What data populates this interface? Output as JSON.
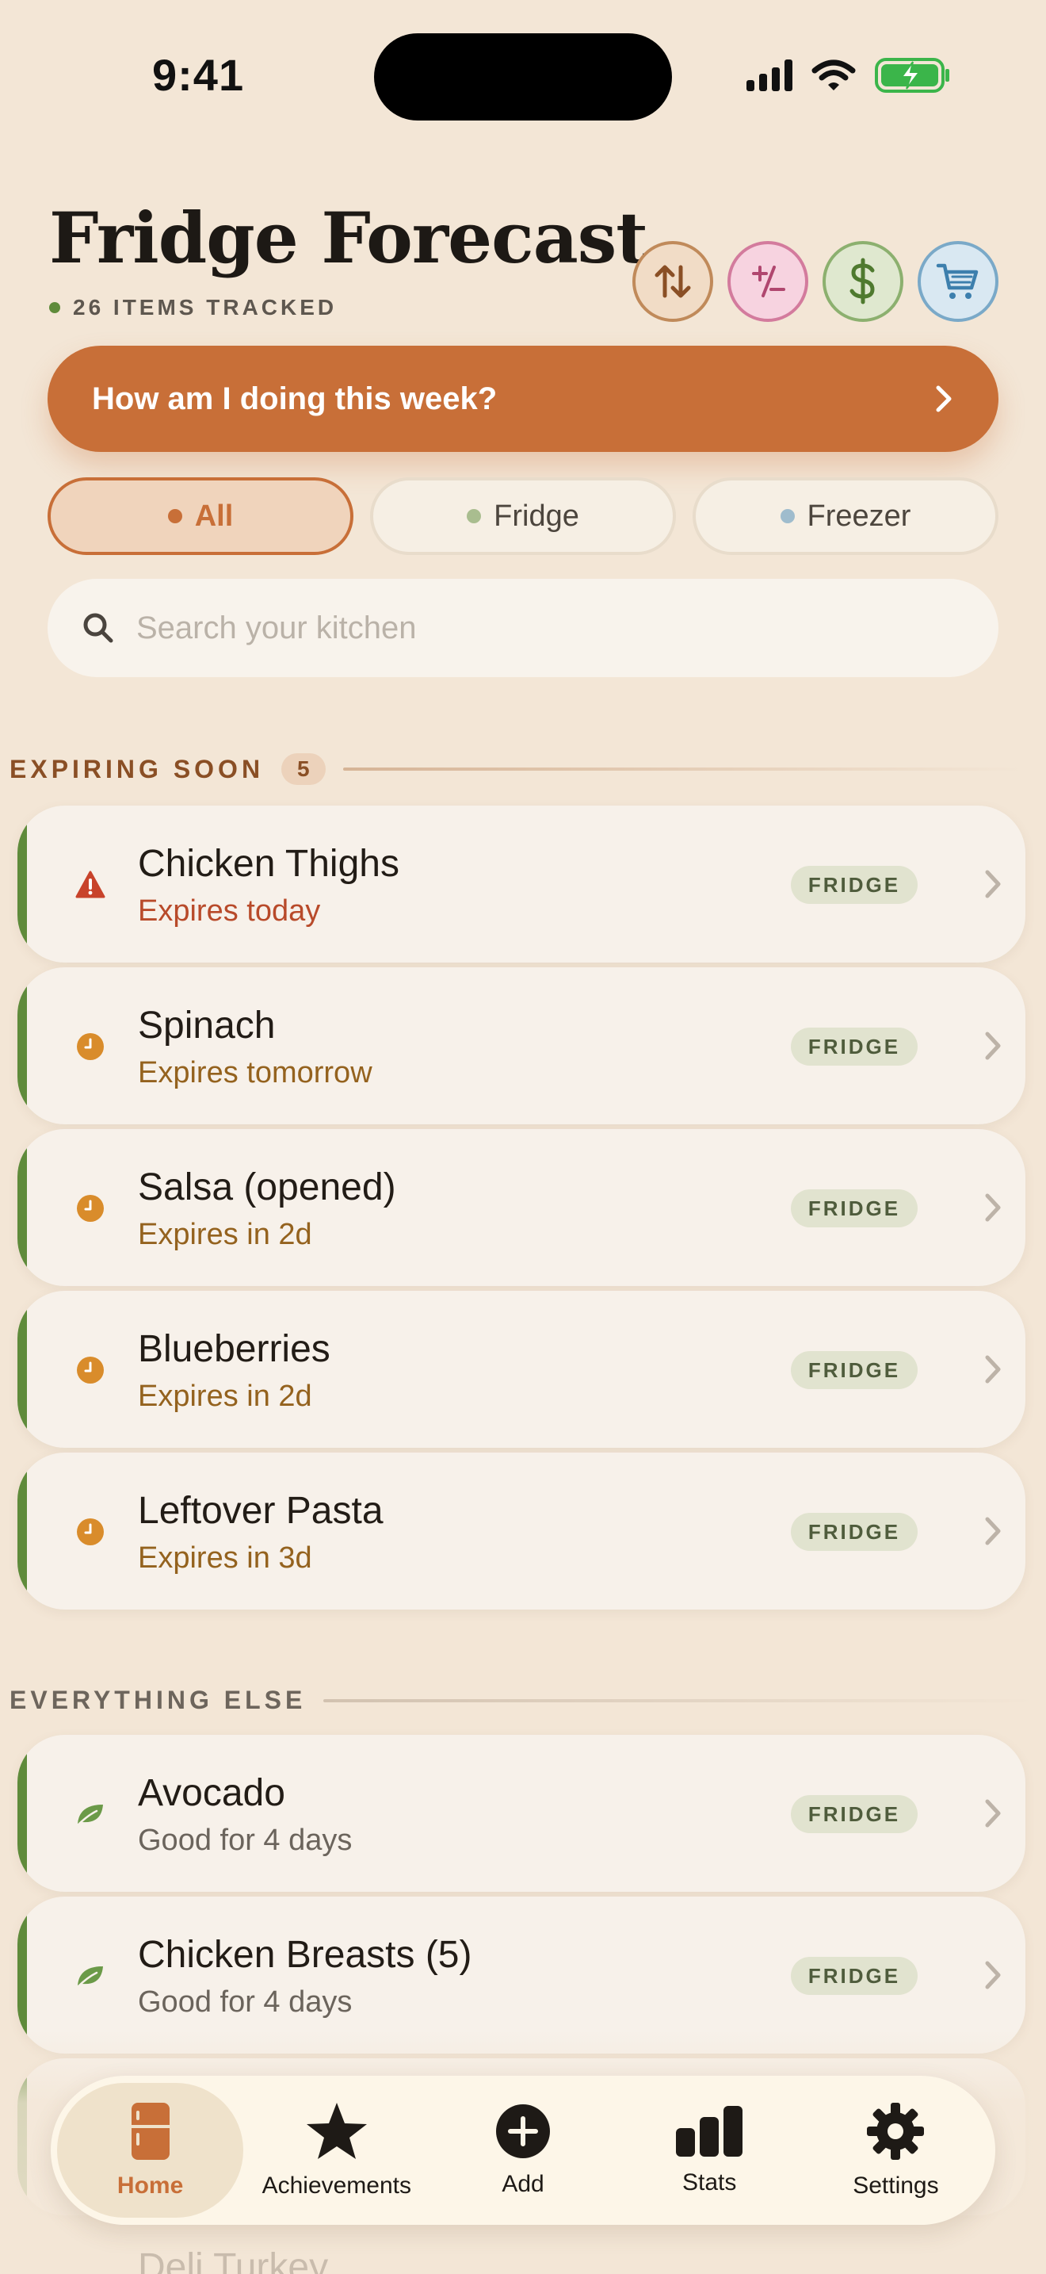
{
  "status_bar": {
    "time": "9:41"
  },
  "header": {
    "title": "Fridge Forecast",
    "subtitle": "26 ITEMS TRACKED",
    "buttons": [
      "sort-icon",
      "plus-minus-icon",
      "dollar-icon",
      "cart-icon"
    ]
  },
  "banner": {
    "text": "How am I doing this week?",
    "color": "#c86f38"
  },
  "filters": {
    "all": "All",
    "fridge": "Fridge",
    "freezer": "Freezer",
    "dot_colors": {
      "all": "#c86f38",
      "fridge": "#a9bd8f",
      "freezer": "#9fbccd"
    }
  },
  "search": {
    "placeholder": "Search your kitchen",
    "value": ""
  },
  "sections": {
    "expiring": {
      "title": "EXPIRING SOON",
      "count": "5",
      "items": [
        {
          "name": "Chicken Thighs",
          "status": "Expires today",
          "location": "FRIDGE",
          "icon": "warning-icon"
        },
        {
          "name": "Spinach",
          "status": "Expires tomorrow",
          "location": "FRIDGE",
          "icon": "clock-icon"
        },
        {
          "name": "Salsa (opened)",
          "status": "Expires in 2d",
          "location": "FRIDGE",
          "icon": "clock-icon"
        },
        {
          "name": "Blueberries",
          "status": "Expires in 2d",
          "location": "FRIDGE",
          "icon": "clock-icon"
        },
        {
          "name": "Leftover Pasta",
          "status": "Expires in 3d",
          "location": "FRIDGE",
          "icon": "clock-icon"
        }
      ]
    },
    "everything_else": {
      "title": "EVERYTHING ELSE",
      "items": [
        {
          "name": "Avocado",
          "status": "Good for 4 days",
          "location": "FRIDGE",
          "icon": "leaf-icon"
        },
        {
          "name": "Chicken Breasts (5)",
          "status": "Good for 4 days",
          "location": "FRIDGE",
          "icon": "leaf-icon"
        }
      ]
    }
  },
  "partially_hidden": {
    "text": "Deli Turkey"
  },
  "nav": {
    "home": "Home",
    "achievements": "Achievements",
    "add": "Add",
    "stats": "Stats",
    "settings": "Settings",
    "active": "home"
  }
}
